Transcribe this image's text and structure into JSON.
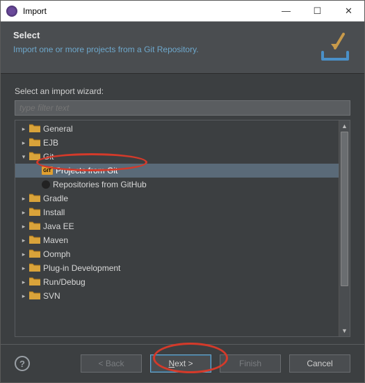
{
  "titlebar": {
    "title": "Import"
  },
  "header": {
    "title": "Select",
    "description": "Import one or more projects from a Git Repository."
  },
  "body": {
    "label": "Select an import wizard:",
    "filter_placeholder": "type filter text"
  },
  "tree": [
    {
      "label": "General",
      "depth": 0,
      "expanded": false,
      "icon": "folder",
      "selected": false
    },
    {
      "label": "EJB",
      "depth": 0,
      "expanded": false,
      "icon": "folder",
      "selected": false
    },
    {
      "label": "Git",
      "depth": 0,
      "expanded": true,
      "icon": "folder",
      "selected": false
    },
    {
      "label": "Projects from Git",
      "depth": 1,
      "expanded": null,
      "icon": "git",
      "selected": true
    },
    {
      "label": "Repositories from GitHub",
      "depth": 1,
      "expanded": null,
      "icon": "github",
      "selected": false
    },
    {
      "label": "Gradle",
      "depth": 0,
      "expanded": false,
      "icon": "folder",
      "selected": false
    },
    {
      "label": "Install",
      "depth": 0,
      "expanded": false,
      "icon": "folder",
      "selected": false
    },
    {
      "label": "Java EE",
      "depth": 0,
      "expanded": false,
      "icon": "folder",
      "selected": false
    },
    {
      "label": "Maven",
      "depth": 0,
      "expanded": false,
      "icon": "folder",
      "selected": false
    },
    {
      "label": "Oomph",
      "depth": 0,
      "expanded": false,
      "icon": "folder",
      "selected": false
    },
    {
      "label": "Plug-in Development",
      "depth": 0,
      "expanded": false,
      "icon": "folder",
      "selected": false
    },
    {
      "label": "Run/Debug",
      "depth": 0,
      "expanded": false,
      "icon": "folder",
      "selected": false
    },
    {
      "label": "SVN",
      "depth": 0,
      "expanded": false,
      "icon": "folder",
      "selected": false
    }
  ],
  "footer": {
    "back": "< Back",
    "next": "Next >",
    "finish": "Finish",
    "cancel": "Cancel"
  }
}
